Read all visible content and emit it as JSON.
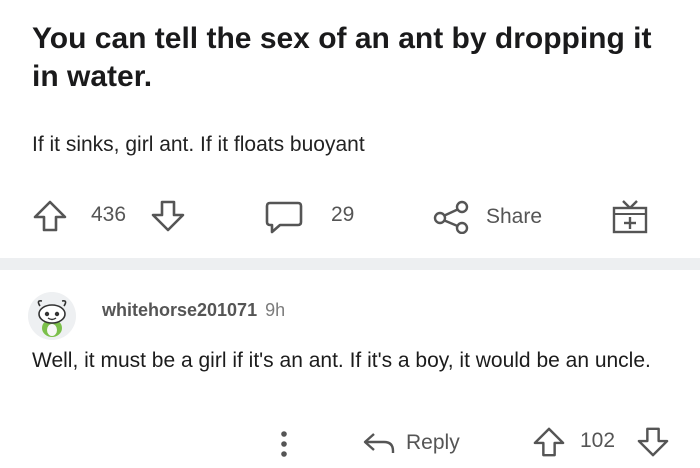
{
  "post": {
    "title": "You can tell the sex of an ant by dropping it in water.",
    "body": "If it sinks, girl ant. If it floats buoyant",
    "upvote_icon": "arrow-up-outline-icon",
    "downvote_icon": "arrow-down-outline-icon",
    "score": "436",
    "comments_icon": "chat-bubble-icon",
    "comments_count": "29",
    "share_icon": "share-nodes-icon",
    "share_label": "Share",
    "award_icon": "gift-box-icon"
  },
  "comment": {
    "avatar_icon": "snoo-avatar-icon",
    "username": "whitehorse201071",
    "age": "9h",
    "text": "Well, it must be a girl if it's an ant. If it's a boy, it would be an uncle.",
    "more_icon": "vertical-ellipsis-icon",
    "reply_icon": "reply-arrow-icon",
    "reply_label": "Reply",
    "score": "102"
  },
  "colors": {
    "icon_gray": "#555555",
    "separator": "#edeff1",
    "text": "#1a1a1b"
  }
}
